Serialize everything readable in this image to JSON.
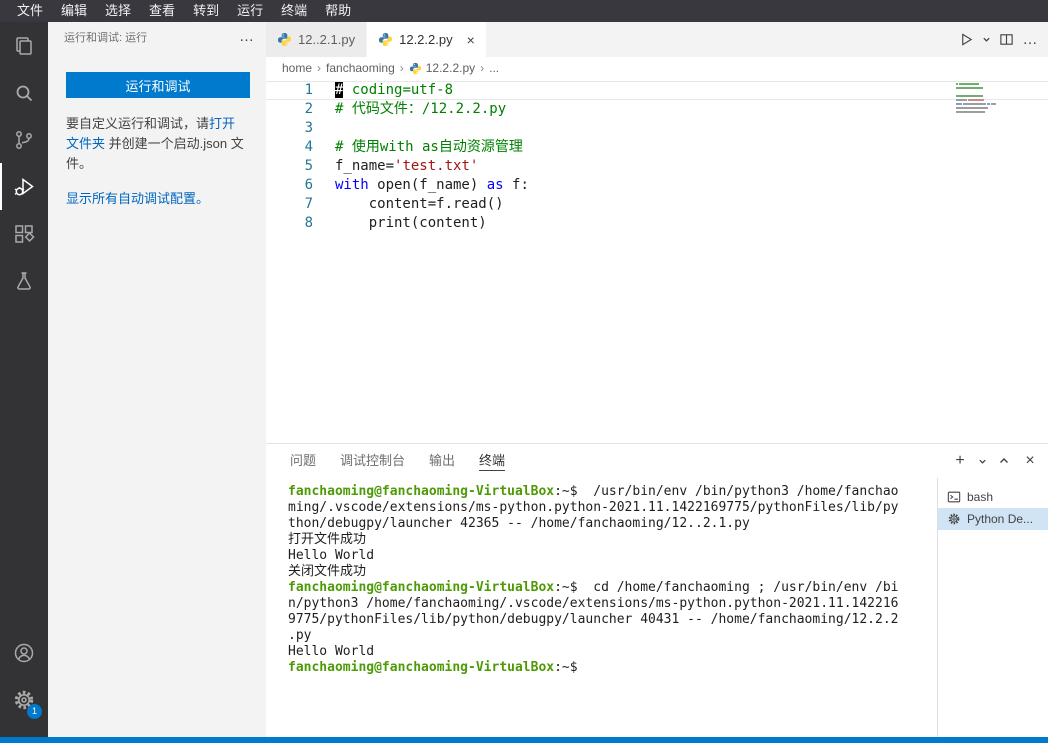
{
  "menu": {
    "items": [
      "文件",
      "编辑",
      "选择",
      "查看",
      "转到",
      "运行",
      "终端",
      "帮助"
    ]
  },
  "activity_bar": {
    "items": [
      "explorer",
      "search",
      "source-control",
      "run-and-debug",
      "extensions",
      "testing"
    ],
    "active": "run-and-debug",
    "badge": "1"
  },
  "sidebar": {
    "header": "运行和调试: 运行",
    "run_button": "运行和调试",
    "hint_pre": "要自定义运行和调试，请",
    "hint_link": "打开文件夹",
    "hint_post": " 并创建一个启动.json 文件。",
    "config_link": "显示所有自动调试配置。"
  },
  "editor": {
    "tabs": [
      {
        "label": "12..2.1.py",
        "active": false
      },
      {
        "label": "12.2.2.py",
        "active": true
      }
    ],
    "breadcrumb": [
      {
        "label": "home"
      },
      {
        "label": "fanchaoming"
      },
      {
        "label": "12.2.2.py",
        "file": true
      },
      {
        "label": "..."
      }
    ],
    "lines": [
      {
        "num": "1",
        "current": true,
        "segments": [
          {
            "t": "#",
            "c": "comment",
            "cursor": true
          },
          {
            "t": " coding=utf-8",
            "c": "comment"
          }
        ]
      },
      {
        "num": "2",
        "segments": [
          {
            "t": "# 代码文件：/12.2.2.py",
            "c": "comment"
          }
        ]
      },
      {
        "num": "3",
        "segments": []
      },
      {
        "num": "4",
        "segments": [
          {
            "t": "# 使用with as自动资源管理",
            "c": "comment"
          }
        ]
      },
      {
        "num": "5",
        "segments": [
          {
            "t": "f_name=",
            "c": "plain"
          },
          {
            "t": "'test.txt'",
            "c": "string"
          }
        ]
      },
      {
        "num": "6",
        "segments": [
          {
            "t": "with",
            "c": "keyword"
          },
          {
            "t": " open(f_name) ",
            "c": "plain"
          },
          {
            "t": "as",
            "c": "keyword"
          },
          {
            "t": " f:",
            "c": "plain"
          }
        ]
      },
      {
        "num": "7",
        "segments": [
          {
            "t": "    content=f.read()",
            "c": "plain"
          }
        ]
      },
      {
        "num": "8",
        "segments": [
          {
            "t": "    print(content)",
            "c": "plain"
          }
        ]
      }
    ]
  },
  "panel": {
    "tabs": [
      {
        "label": "问题",
        "active": false
      },
      {
        "label": "调试控制台",
        "active": false
      },
      {
        "label": "输出",
        "active": false
      },
      {
        "label": "终端",
        "active": true
      }
    ],
    "terminal_lines": [
      {
        "prompt": "fanchaoming@fanchaoming-VirtualBox",
        "ps": ":~$",
        "text": "  /usr/bin/env /bin/python3 /home/fanchao"
      },
      {
        "text": "ming/.vscode/extensions/ms-python.python-2021.11.1422169775/pythonFiles/lib/py"
      },
      {
        "text": "thon/debugpy/launcher 42365 -- /home/fanchaoming/12..2.1.py"
      },
      {
        "text": "打开文件成功"
      },
      {
        "text": "Hello World"
      },
      {
        "text": "关闭文件成功"
      },
      {
        "prompt": "fanchaoming@fanchaoming-VirtualBox",
        "ps": ":~$",
        "text": "  cd /home/fanchaoming ; /usr/bin/env /bi"
      },
      {
        "text": "n/python3 /home/fanchaoming/.vscode/extensions/ms-python.python-2021.11.142216"
      },
      {
        "text": "9775/pythonFiles/lib/python/debugpy/launcher 40431 -- /home/fanchaoming/12.2.2"
      },
      {
        "text": ".py"
      },
      {
        "text": "Hello World"
      },
      {
        "prompt": "fanchaoming@fanchaoming-VirtualBox",
        "ps": ":~$",
        "text": ""
      }
    ],
    "terminal_list": [
      {
        "label": "bash",
        "icon": "terminal-icon",
        "selected": false
      },
      {
        "label": "Python De...",
        "icon": "gear-icon",
        "selected": true
      }
    ]
  },
  "glyphs": {
    "more": "…",
    "close": "×",
    "plus": "+",
    "breadcrumb_sep": "›"
  },
  "colors": {
    "accent": "#007acc",
    "menubar_bg": "#38383e",
    "activitybar_bg": "#333336",
    "sidebar_bg": "#f3f3f3",
    "terminal_prompt_green": "#4e9a06",
    "comment_green": "#008000",
    "string_red": "#a31515",
    "keyword_blue": "#0000ff",
    "statusbar_blue": "#007acc",
    "terminal_selected_bg": "#d0e4f5"
  }
}
